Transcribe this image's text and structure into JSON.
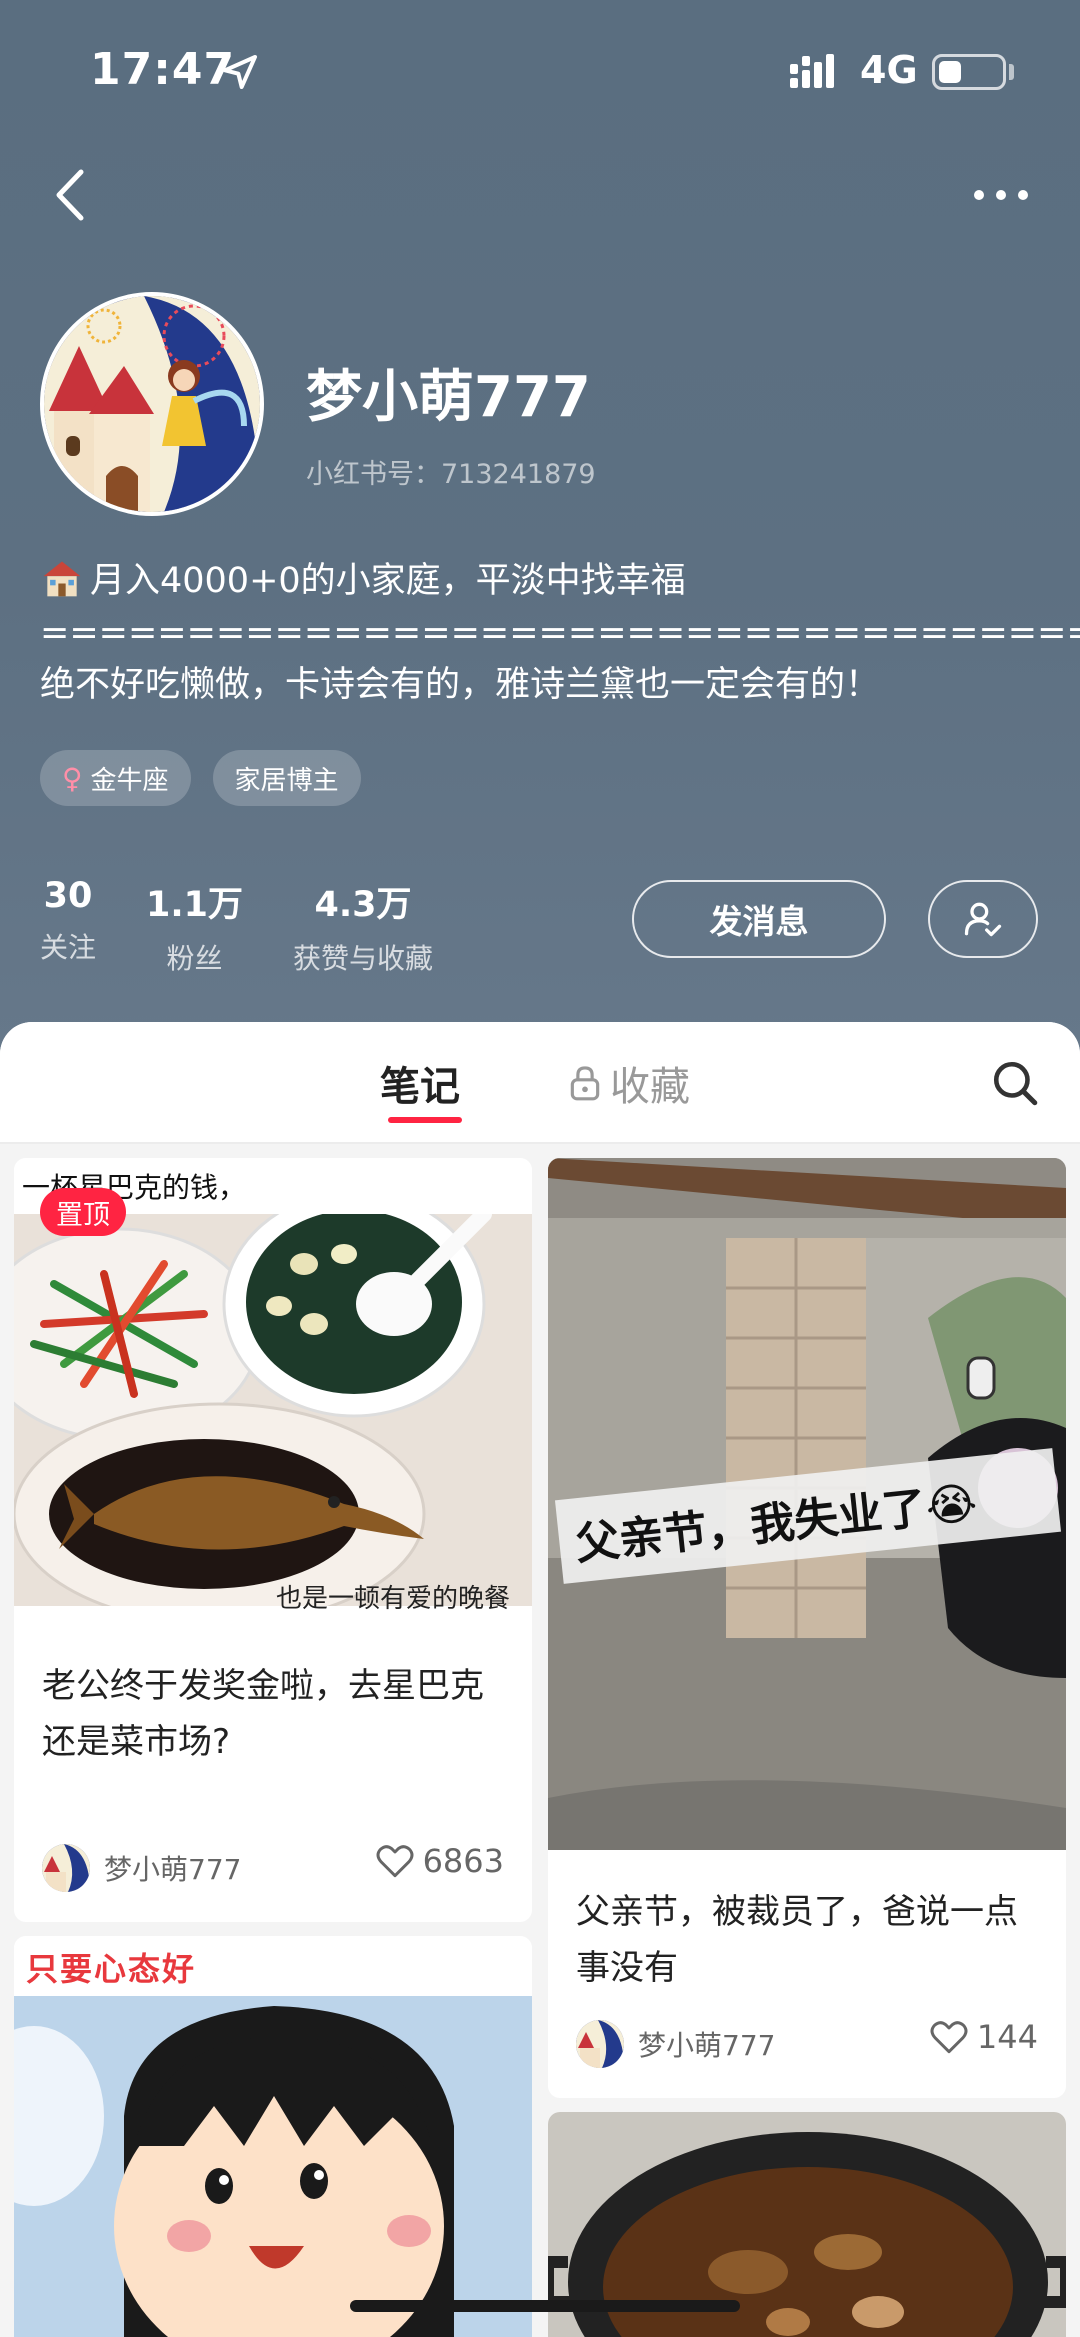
{
  "status_bar": {
    "time": "17:47",
    "network": "4G",
    "battery_level": 0.35
  },
  "profile": {
    "name": "梦小萌777",
    "id_label": "小红书号：713241879",
    "bio": [
      "月入4000+0的小家庭，平淡中找幸福",
      "====================================",
      "绝不好吃懒做，卡诗会有的，雅诗兰黛也一定会有的！"
    ],
    "tags": [
      {
        "label": "金牛座",
        "icon": "female-icon"
      },
      {
        "label": "家居博主"
      }
    ],
    "stats": [
      {
        "value": "30",
        "label": "关注"
      },
      {
        "value": "1.1万",
        "label": "粉丝"
      },
      {
        "value": "4.3万",
        "label": "获赞与收藏"
      }
    ],
    "message_button": "发消息"
  },
  "tabs": {
    "notes": "笔记",
    "favorites": "收藏"
  },
  "notes": [
    {
      "pinned_label": "置顶",
      "image_top_text": "一杯星巴克的钱，",
      "image_caption": "也是一顿有爱的晚餐",
      "title": "老公终于发奖金啦，去星巴克还是菜市场?",
      "author": "梦小萌777",
      "likes": "6863"
    },
    {
      "image_text": "父亲节，我失业了😭",
      "title": "父亲节，被裁员了，爸说一点事没有",
      "author": "梦小萌777",
      "likes": "144"
    },
    {
      "image_top_text": "只要心态好"
    },
    {}
  ],
  "colors": {
    "accent": "#ff2442",
    "header_bg": "#5d7082"
  }
}
